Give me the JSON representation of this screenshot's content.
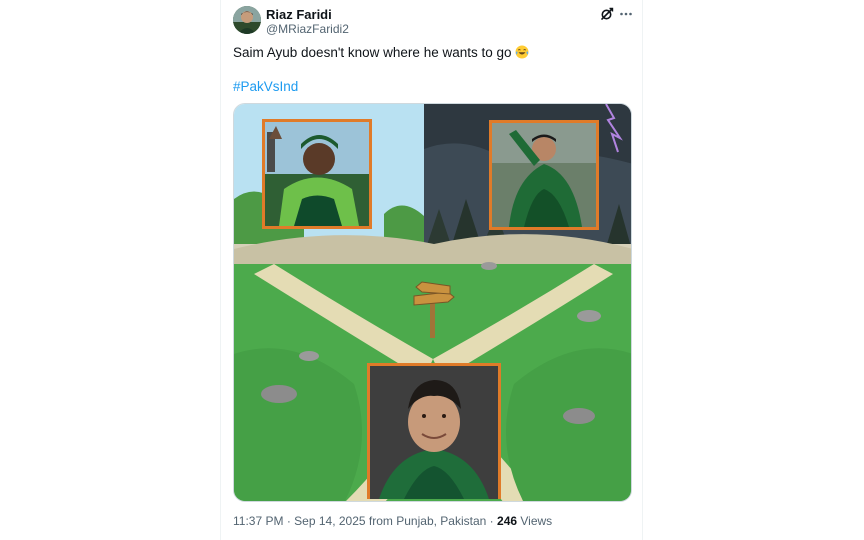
{
  "tweet": {
    "author_name": "Riaz Faridi",
    "author_handle": "@MRiazFaridi2",
    "text": "Saim Ayub doesn't know where he wants to go",
    "emoji": "face-with-tears-of-joy",
    "hashtag": "#PakVsInd",
    "media": {
      "description_icons": [
        "signpost-icon",
        "crossroads-path",
        "player-photo-top-left",
        "player-photo-top-right",
        "player-photo-bottom"
      ]
    },
    "time": "11:37 PM",
    "separator": "·",
    "date": "Sep 14, 2025",
    "location": "from Punjab, Pakistan",
    "views_count": "246",
    "views_label": "Views"
  },
  "icons": {
    "grok": "grok-icon",
    "more": "more-options-icon"
  },
  "colors": {
    "text_primary": "#0f1419",
    "text_secondary": "#536471",
    "link": "#1d9bf0",
    "border": "#eff3f4"
  }
}
